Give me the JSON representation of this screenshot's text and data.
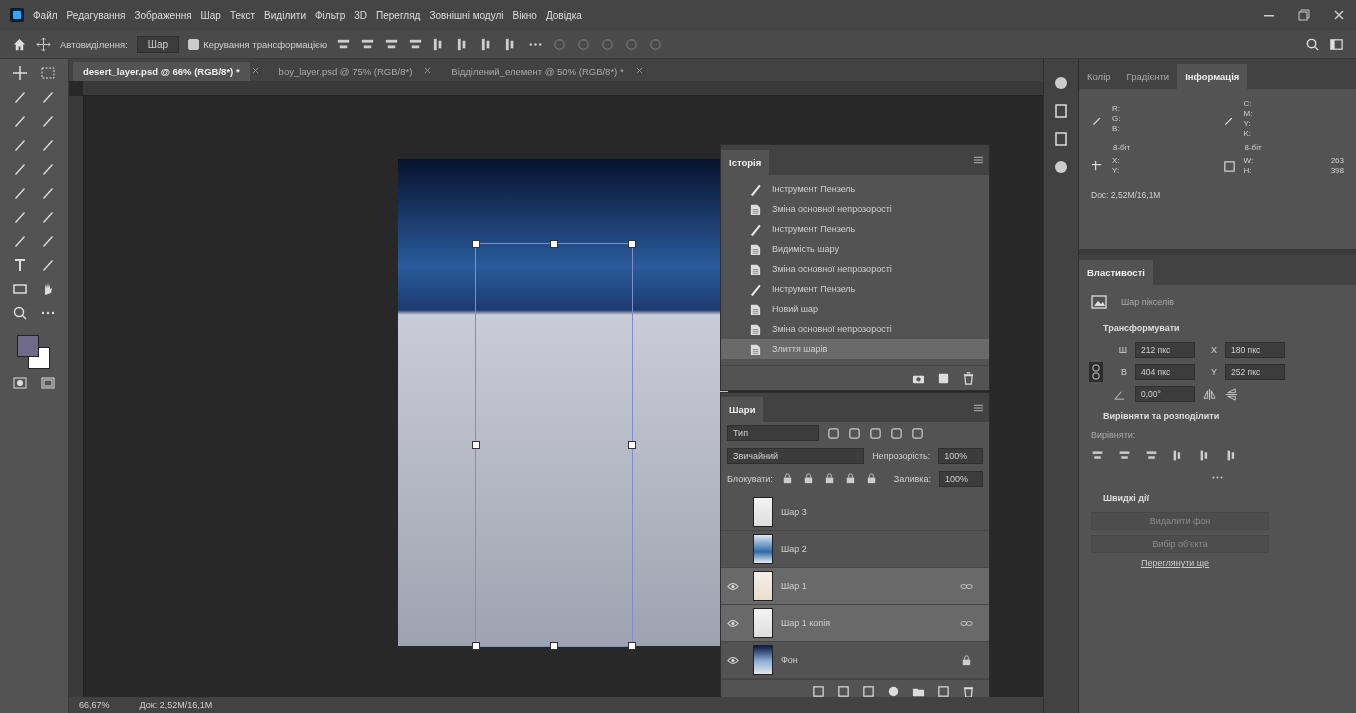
{
  "menu": [
    "Файл",
    "Редагування",
    "Зображення",
    "Шар",
    "Текст",
    "Виділити",
    "Фільтр",
    "3D",
    "Перегляд",
    "Зовнішні модулі",
    "Вікно",
    "Довідка"
  ],
  "options_bar": {
    "auto_select_label": "Автовиділення:",
    "auto_select_target": "Шар",
    "show_transform": {
      "label": "Керування трансформацією",
      "checked": true
    }
  },
  "document_tabs": [
    {
      "label": "desert_layer.psd @ 66% (RGB/8*) *",
      "selected": true
    },
    {
      "label": "boy_layer.psd @ 75% (RGB/8*)",
      "selected": false
    },
    {
      "label": "Відділений_елемент @ 50% (RGB/8*) *",
      "selected": false
    }
  ],
  "history": {
    "title": "Історія",
    "items": [
      {
        "kind": "brush",
        "label": "Інструмент Пензель",
        "selected": false
      },
      {
        "kind": "document",
        "label": "Зміна основної непрозорості",
        "selected": false
      },
      {
        "kind": "brush",
        "label": "Інструмент Пензель",
        "selected": false
      },
      {
        "kind": "document",
        "label": "Видимість шару",
        "selected": false
      },
      {
        "kind": "document",
        "label": "Зміна основної непрозорості",
        "selected": false
      },
      {
        "kind": "brush",
        "label": "Інструмент Пензель",
        "selected": false
      },
      {
        "kind": "document",
        "label": "Новий шар",
        "selected": false
      },
      {
        "kind": "document",
        "label": "Зміна основної непрозорості",
        "selected": false
      },
      {
        "kind": "document",
        "label": "Злиття шарів",
        "selected": true
      }
    ]
  },
  "layers": {
    "title": "Шари",
    "filter": "Тип",
    "blend_mode": "Звичайний",
    "opacity_label": "Непрозорість:",
    "opacity": "100%",
    "lock_label": "Блокувати:",
    "fill_label": "Заливка:",
    "fill": "100%",
    "items": [
      {
        "name": "Шар 3",
        "kind": "light",
        "visible": false,
        "selected": false,
        "linked": false,
        "locked": false
      },
      {
        "name": "Шар 2",
        "kind": "blue",
        "visible": false,
        "selected": false,
        "linked": false,
        "locked": false
      },
      {
        "name": "Шар 1",
        "kind": "figure",
        "visible": true,
        "selected": true,
        "linked": true,
        "locked": false
      },
      {
        "name": "Шар 1 копія",
        "kind": "light",
        "visible": true,
        "selected": true,
        "linked": true,
        "locked": false
      },
      {
        "name": "Фон",
        "kind": "sky",
        "visible": true,
        "selected": false,
        "linked": false,
        "locked": true
      }
    ]
  },
  "info": {
    "tabs": [
      {
        "label": "Колір",
        "selected": false
      },
      {
        "label": "Градієнти",
        "selected": false
      },
      {
        "label": "Інформація",
        "selected": true
      }
    ],
    "rgb_labels": [
      "R:",
      "G:",
      "B:"
    ],
    "rgb_depth": "8-біт",
    "cmyk_labels": [
      "C:",
      "M:",
      "Y:",
      "K:"
    ],
    "cmyk_depth": "8-біт",
    "xy_labels": [
      "X:",
      "Y:"
    ],
    "wh_labels": [
      "W:",
      "H:"
    ],
    "wh_values": [
      "263",
      "398"
    ],
    "doc": "Doc: 2,52M/16,1M"
  },
  "properties": {
    "title": "Властивості",
    "layer_type": "Шар пікселів",
    "transform_title": "Трансформувати",
    "fields": [
      {
        "label": "Ш",
        "value": "212 пкс"
      },
      {
        "label": "X",
        "value": "180 пкс"
      },
      {
        "label": "В",
        "value": "404 пкс"
      },
      {
        "label": "Y",
        "value": "252 пкс"
      }
    ],
    "angle": "0,00°",
    "align_title": "Вирівняти та розподілити",
    "align_label": "Вирівняти:",
    "quick_title": "Швидкі дії",
    "quick_buttons": [
      "Видалити фон",
      "Вибір об'єкта"
    ],
    "more_link": "Переглянути ще"
  },
  "status_bar": {
    "zoom": "66,67%",
    "doc": "Док: 2,52M/16,1M"
  }
}
